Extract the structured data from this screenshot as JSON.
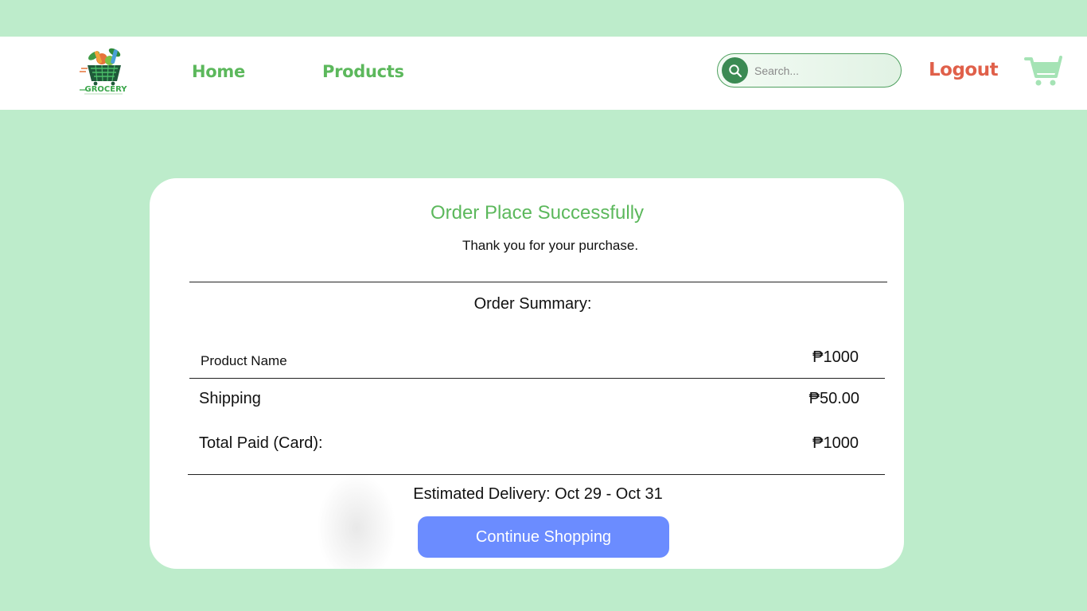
{
  "header": {
    "logo_text": "GROCERY",
    "nav": {
      "home_label": "Home",
      "products_label": "Products"
    },
    "search": {
      "placeholder": "Search...",
      "icon": "search-icon"
    },
    "logout_label": "Logout",
    "cart_icon": "cart-icon"
  },
  "order": {
    "title": "Order Place Successfully",
    "subtitle": "Thank you for your purchase.",
    "summary_title": "Order Summary:",
    "items": [
      {
        "label": "Product Name",
        "value": "₱1000"
      }
    ],
    "shipping": {
      "label": "Shipping",
      "value": "₱50.00"
    },
    "total": {
      "label": "Total Paid (Card):",
      "value": "₱1000"
    },
    "delivery": "Estimated Delivery: Oct 29 - Oct 31",
    "continue_label": "Continue Shopping"
  },
  "colors": {
    "background": "#bdeccb",
    "accent_green": "#5cb85c",
    "logout_red": "#e0604a",
    "button_blue": "#6b8cff"
  }
}
